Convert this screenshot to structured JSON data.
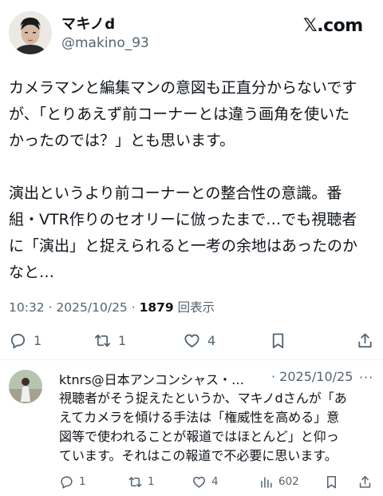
{
  "post": {
    "author_name": "マキノd",
    "author_handle": "@makino_93",
    "source": "𝕏.com",
    "body_lines": [
      "カメラマンと編集マンの意図も正直分からないです",
      "が、「とりあえず前コーナーとは違う画角を使いた",
      "かったのでは？」とも思います。",
      "",
      "演出というより前コーナーとの整合性の意識。番",
      "組・VTR作りのセオリーに倣ったまで…でも視聴者",
      "に「演出」と捉えられると一考の余地はあったのか",
      "なと…"
    ],
    "timestamp": "10:32 · 2025/10/25 · ",
    "view_count": "1879",
    "view_label": " 回表示",
    "actions": {
      "reply_icon": "reply-icon",
      "reply_count": "1",
      "repost_icon": "repost-icon",
      "repost_count": "1",
      "like_icon": "heart-icon",
      "like_count": "4",
      "bookmark_icon": "bookmark-icon",
      "share_icon": "share-icon"
    }
  },
  "reply": {
    "author": "ktnrs@日本アンコンシャス・…",
    "date": "· 2025/10/25",
    "more": "···",
    "text_lines": [
      "視聴者がそう捉えたというか、マキノdさんが「あ",
      "えてカメラを傾ける手法は「権威性を高める」意",
      "図等で使われることが報道ではほとんど」と仰っ",
      "ています。それはこの報道で不必要に思います。"
    ],
    "actions": {
      "reply_count": "1",
      "repost_count": "1",
      "like_count": "4",
      "views_icon": "bar-chart-icon",
      "view_count": "602"
    }
  },
  "colors": {
    "text_primary": "#0f1419",
    "text_secondary": "#536471",
    "divider": "#eff3f4",
    "background": "#ffffff"
  }
}
